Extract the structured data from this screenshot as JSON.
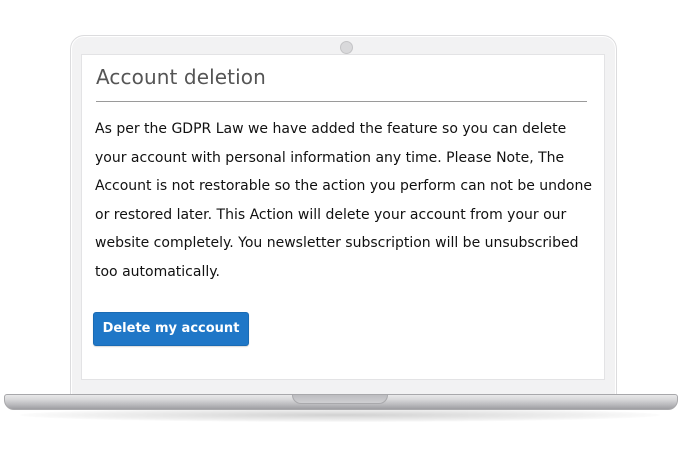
{
  "section": {
    "title": "Account deletion",
    "description": "As per the GDPR Law we have added the feature so you can delete your account with personal information any time. Please Note, The Account is not restorable so the action you perform can not be undone or restored later. This Action will delete your account from your our website completely. You newsletter subscription will be unsubscribed too automatically.",
    "delete_button_label": "Delete my account"
  },
  "colors": {
    "button_background": "#1f77c7",
    "button_text": "#ffffff",
    "heading_text": "#555555",
    "body_text": "#111111"
  },
  "icons": {
    "camera": "laptop-camera-icon"
  }
}
